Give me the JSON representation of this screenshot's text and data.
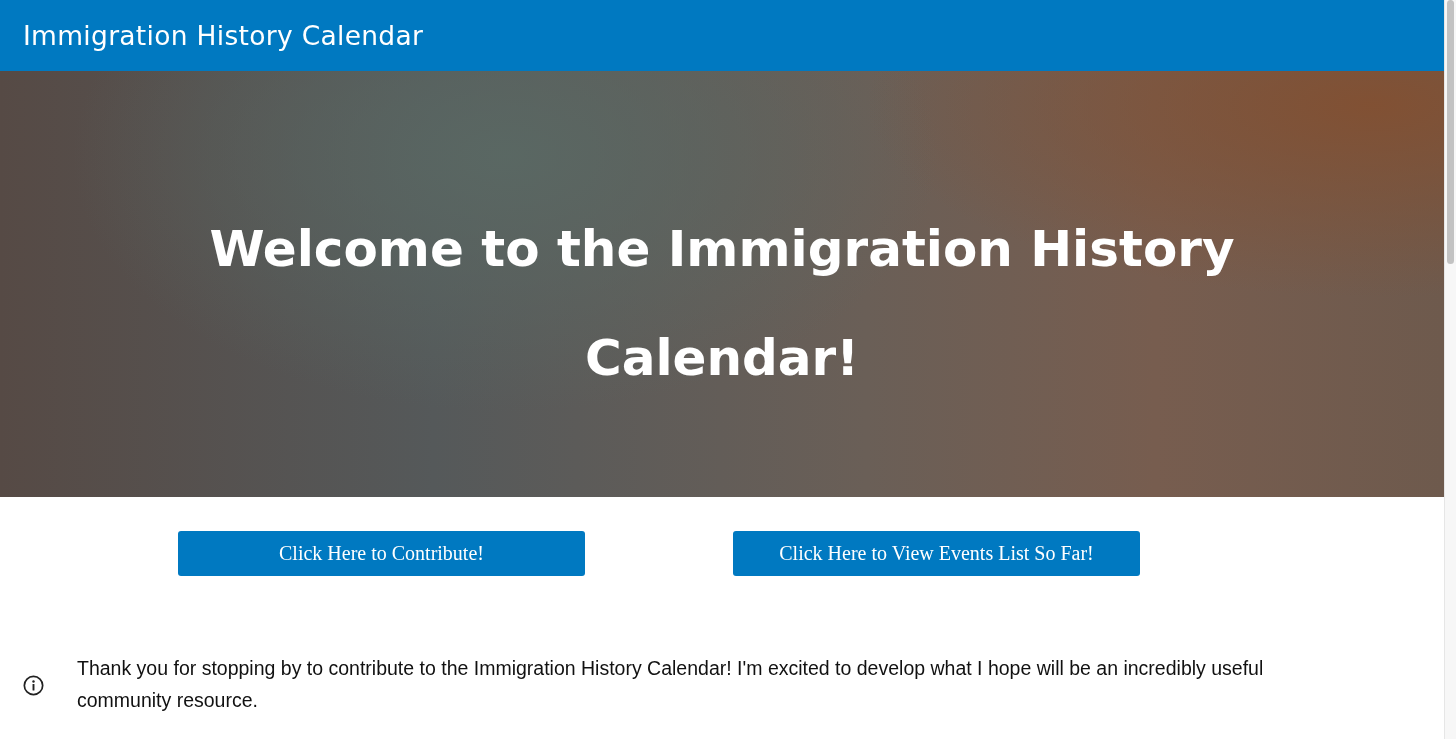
{
  "header": {
    "title": "Immigration History Calendar"
  },
  "hero": {
    "heading": "Welcome to the Immigration History Calendar!"
  },
  "buttons": [
    {
      "label": "Click Here to Contribute!"
    },
    {
      "label": "Click Here to View Events List So Far!"
    }
  ],
  "notice": {
    "text": "Thank you for stopping by to contribute to the Immigration History Calendar! I'm excited to develop what I hope will be an incredibly useful community resource."
  }
}
